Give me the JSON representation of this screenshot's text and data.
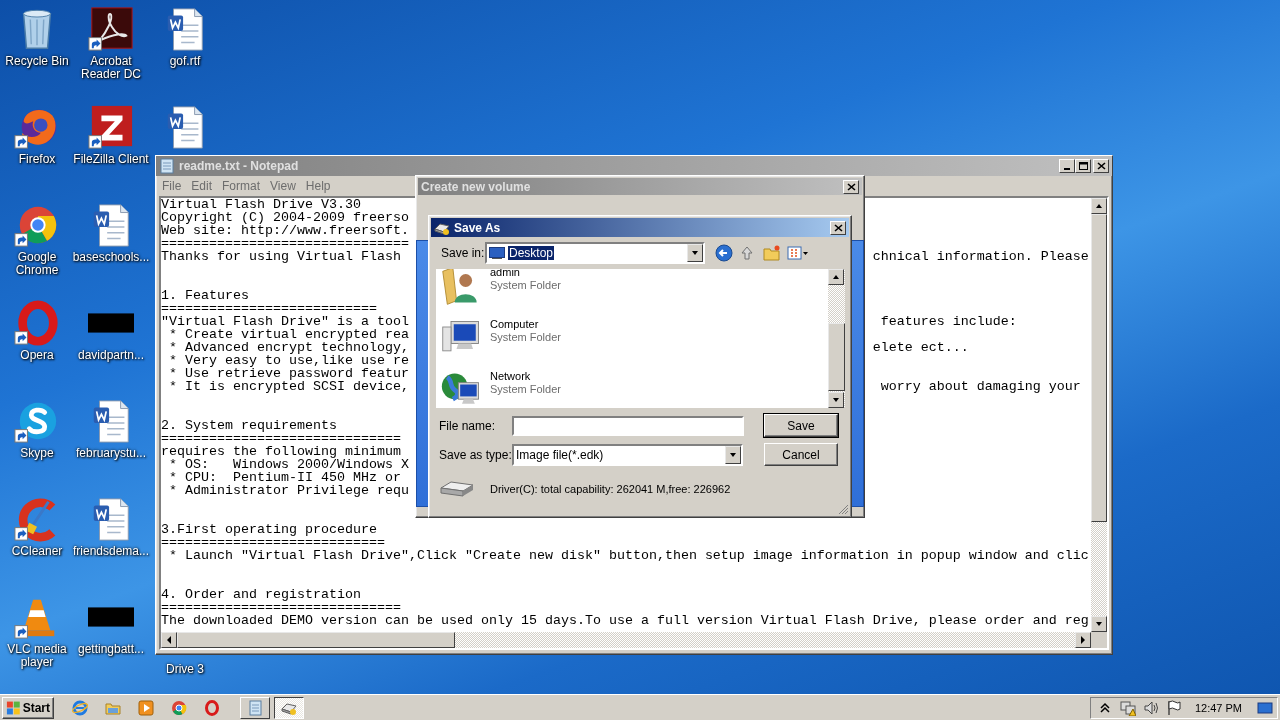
{
  "desktop": {
    "columns": [
      {
        "icons": [
          {
            "label": "Recycle Bin",
            "kind": "recycle-bin",
            "shortcut": false
          },
          {
            "label": "Firefox",
            "kind": "firefox",
            "shortcut": true
          },
          {
            "label": "Google Chrome",
            "kind": "chrome",
            "shortcut": true
          },
          {
            "label": "Opera",
            "kind": "opera",
            "shortcut": true
          },
          {
            "label": "Skype",
            "kind": "skype",
            "shortcut": true
          },
          {
            "label": "CCleaner",
            "kind": "ccleaner",
            "shortcut": true
          },
          {
            "label": "VLC media player",
            "kind": "vlc",
            "shortcut": true
          }
        ]
      },
      {
        "icons": [
          {
            "label": "Acrobat Reader DC",
            "kind": "pdf",
            "shortcut": true
          },
          {
            "label": "FileZilla Client",
            "kind": "filezilla",
            "shortcut": true
          },
          {
            "label": "baseschools...",
            "kind": "word",
            "shortcut": false
          },
          {
            "label": "davidpartn...",
            "kind": "redacted",
            "shortcut": false
          },
          {
            "label": "februarystu...",
            "kind": "word",
            "shortcut": false
          },
          {
            "label": "friendsdema...",
            "kind": "word",
            "shortcut": false
          },
          {
            "label": "gettingbatt...",
            "kind": "redacted",
            "shortcut": false
          }
        ]
      },
      {
        "icons": [
          {
            "label": "gof.rtf",
            "kind": "word",
            "shortcut": false
          },
          {
            "kind": "word",
            "shortcut": false
          },
          {
            "label": "Drive 3",
            "kind": "label-only"
          }
        ]
      }
    ]
  },
  "notepad": {
    "title": "readme.txt - Notepad",
    "menu": [
      "File",
      "Edit",
      "Format",
      "View",
      "Help"
    ],
    "lines": [
      {
        "kind": "text",
        "text": "Virtual Flash Drive V3.30"
      },
      {
        "kind": "text",
        "text": "Copyright (C) 2004-2009 freerso"
      },
      {
        "kind": "text",
        "text": "Web site: http://www.freersoft."
      },
      {
        "kind": "text",
        "text": "==============================="
      },
      {
        "kind": "text",
        "text": "Thanks for using Virtual Flash ",
        "right": "chnical information. Please"
      },
      {
        "kind": "blank"
      },
      {
        "kind": "blank"
      },
      {
        "kind": "text",
        "text": "1. Features"
      },
      {
        "kind": "text",
        "text": "==========================="
      },
      {
        "kind": "text",
        "text": "\"Virtual Flash Drive\" is a tool",
        "right": " features include:"
      },
      {
        "kind": "text",
        "text": " * Create virtual encrypted rea"
      },
      {
        "kind": "text",
        "text": " * Advanced encrypt technology,",
        "right": "elete ect..."
      },
      {
        "kind": "text",
        "text": " * Very easy to use,like use re"
      },
      {
        "kind": "text",
        "text": " * Use retrieve password featur"
      },
      {
        "kind": "text",
        "text": " * It is encrypted SCSI device,",
        "right": " worry about damaging your"
      },
      {
        "kind": "blank"
      },
      {
        "kind": "blank"
      },
      {
        "kind": "text",
        "text": "2. System requirements"
      },
      {
        "kind": "text",
        "text": "=============================="
      },
      {
        "kind": "text",
        "text": "requires the following minimum"
      },
      {
        "kind": "text",
        "text": " * OS:   Windows 2000/Windows X"
      },
      {
        "kind": "text",
        "text": " * CPU:  Pentium-II 450 MHz or"
      },
      {
        "kind": "text",
        "text": " * Administrator Privilege requ"
      },
      {
        "kind": "blank"
      },
      {
        "kind": "blank"
      },
      {
        "kind": "text",
        "text": "3.First operating procedure"
      },
      {
        "kind": "text",
        "text": "============================"
      },
      {
        "kind": "text",
        "text": " * Launch \"Virtual Flash Drive\",Click \"Create new disk\" button,then setup image information in popup window and clic"
      },
      {
        "kind": "blank"
      },
      {
        "kind": "blank"
      },
      {
        "kind": "text",
        "text": "4. Order and registration"
      },
      {
        "kind": "text",
        "text": "=============================="
      },
      {
        "kind": "text",
        "text": "The downloaded DEMO version can be used only 15 days.To use a full version Virtual Flash Drive, please order and reg"
      }
    ]
  },
  "create_volume": {
    "title": "Create new volume"
  },
  "save_as": {
    "title": "Save As",
    "save_in_label": "Save in:",
    "save_in_value": "Desktop",
    "items": [
      {
        "name": "admin",
        "type": "System Folder",
        "kind": "user"
      },
      {
        "name": "Computer",
        "type": "System Folder",
        "kind": "computer"
      },
      {
        "name": "Network",
        "type": "System Folder",
        "kind": "network"
      }
    ],
    "file_name_label": "File name:",
    "type_label": "Save as type:",
    "type_value": "Image file(*.edk)",
    "buttons": [
      {
        "label": "Save",
        "default": true
      },
      {
        "label": "Cancel",
        "default": false
      }
    ],
    "drive_info": "Driver(C): total capability: 262041 M,free: 226962"
  },
  "taskbar": {
    "start": "Start",
    "quick_launch": [
      {
        "kind": "ie"
      },
      {
        "kind": "explorer"
      },
      {
        "kind": "media"
      },
      {
        "kind": "chrome"
      },
      {
        "kind": "opera"
      }
    ],
    "tasks": [
      {
        "kind": "notepad",
        "selected": false
      },
      {
        "kind": "flash-drive",
        "selected": true
      }
    ],
    "tray": [
      {
        "kind": "chevron"
      },
      {
        "kind": "network"
      },
      {
        "kind": "volume"
      },
      {
        "kind": "flag"
      }
    ],
    "clock": "12:47 PM"
  }
}
